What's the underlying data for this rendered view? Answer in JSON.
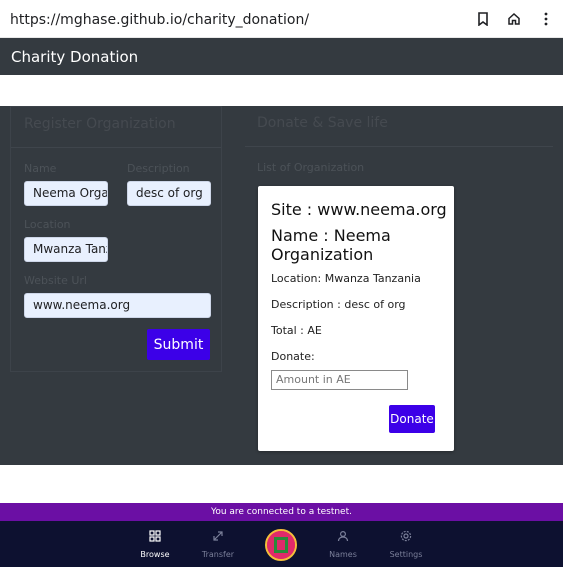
{
  "browser": {
    "url": "https://mghase.github.io/charity_donation/",
    "icons": [
      "bookmark-icon",
      "home-icon",
      "more-vert-icon"
    ]
  },
  "app": {
    "title": "Charity Donation"
  },
  "register": {
    "title": "Register Organization",
    "name_label": "Name",
    "name_value": "Neema Organi",
    "description_label": "Description",
    "description_value": "desc of org",
    "location_label": "Location",
    "location_value": "Mwanza Tanza",
    "website_label": "Website Url",
    "website_value": "www.neema.org",
    "submit_label": "Submit"
  },
  "donate": {
    "title": "Donate & Save life",
    "list_label": "List of Organization",
    "card": {
      "site": "Site : www.neema.org",
      "name": "Name : Neema Organization",
      "location": "Location: Mwanza Tanzania",
      "description": "Description : desc of org",
      "total": "Total : AE",
      "donate_label": "Donate:",
      "amount_placeholder": "Amount in AE",
      "donate_button": "Donate"
    }
  },
  "testnet": {
    "message": "You are connected to a testnet."
  },
  "nav": {
    "items": [
      {
        "label": "Browse",
        "icon": "grid-icon",
        "active": true
      },
      {
        "label": "Transfer",
        "icon": "transfer-icon",
        "active": false
      },
      {
        "label": "Names",
        "icon": "user-icon",
        "active": false
      },
      {
        "label": "Settings",
        "icon": "gear-icon",
        "active": false
      }
    ]
  },
  "colors": {
    "header_bg": "#343a40",
    "accent": "#3c00e8",
    "testnet_bg": "#6b0fa4",
    "nav_bg": "#0d1130"
  }
}
